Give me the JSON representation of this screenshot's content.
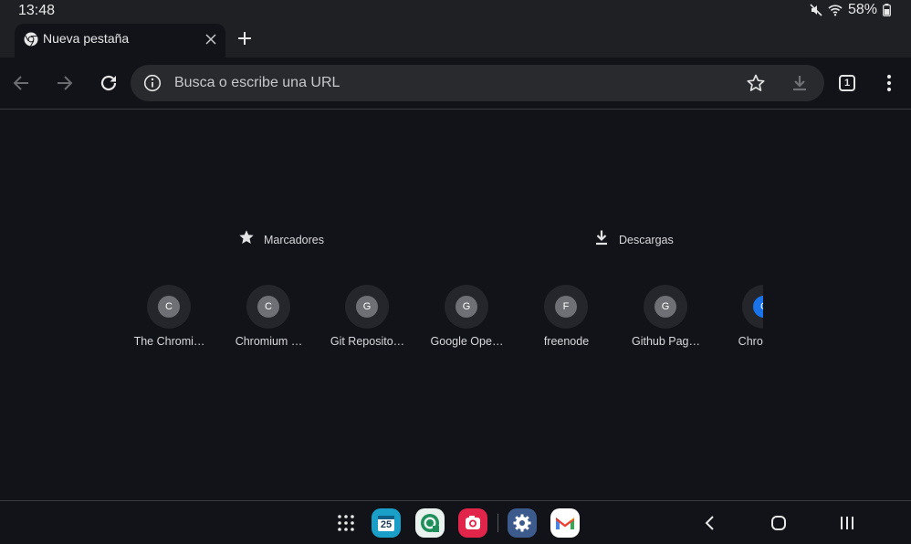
{
  "status_bar": {
    "time": "13:48",
    "battery": "58%",
    "icons": [
      "mute-icon",
      "wifi-icon",
      "battery-charging-icon"
    ]
  },
  "tab": {
    "title": "Nueva pestaña",
    "favicon": "chrome-icon"
  },
  "toolbar": {
    "omnibox_placeholder": "Busca o escribe una URL",
    "tab_count": "1"
  },
  "quick_links": [
    {
      "label": "Marcadores",
      "icon": "star-icon"
    },
    {
      "label": "Descargas",
      "icon": "download-icon"
    }
  ],
  "most_visited": [
    {
      "letter": "C",
      "title": "The Chromi…"
    },
    {
      "letter": "C",
      "title": "Chromium …"
    },
    {
      "letter": "G",
      "title": "Git Reposito…"
    },
    {
      "letter": "G",
      "title": "Google Ope…"
    },
    {
      "letter": "F",
      "title": "freenode"
    },
    {
      "letter": "G",
      "title": "Github Pag…"
    },
    {
      "letter": "C",
      "title": "Chromium"
    }
  ],
  "nav_bar": {
    "dock_apps": [
      "apps-grid-icon",
      "calendar-icon",
      "chat-app-icon",
      "camera-app-icon",
      "settings-icon",
      "gmail-icon"
    ],
    "calendar_day": "25",
    "buttons": [
      "back-icon",
      "home-icon",
      "recents-icon"
    ]
  },
  "colors": {
    "background": "#121318",
    "tab_strip": "#1f2024",
    "omnibox": "#282a2e",
    "tile_ring": "#24262c",
    "tile_letter": "#6f7075",
    "accent_blue": "#1a73e8"
  }
}
